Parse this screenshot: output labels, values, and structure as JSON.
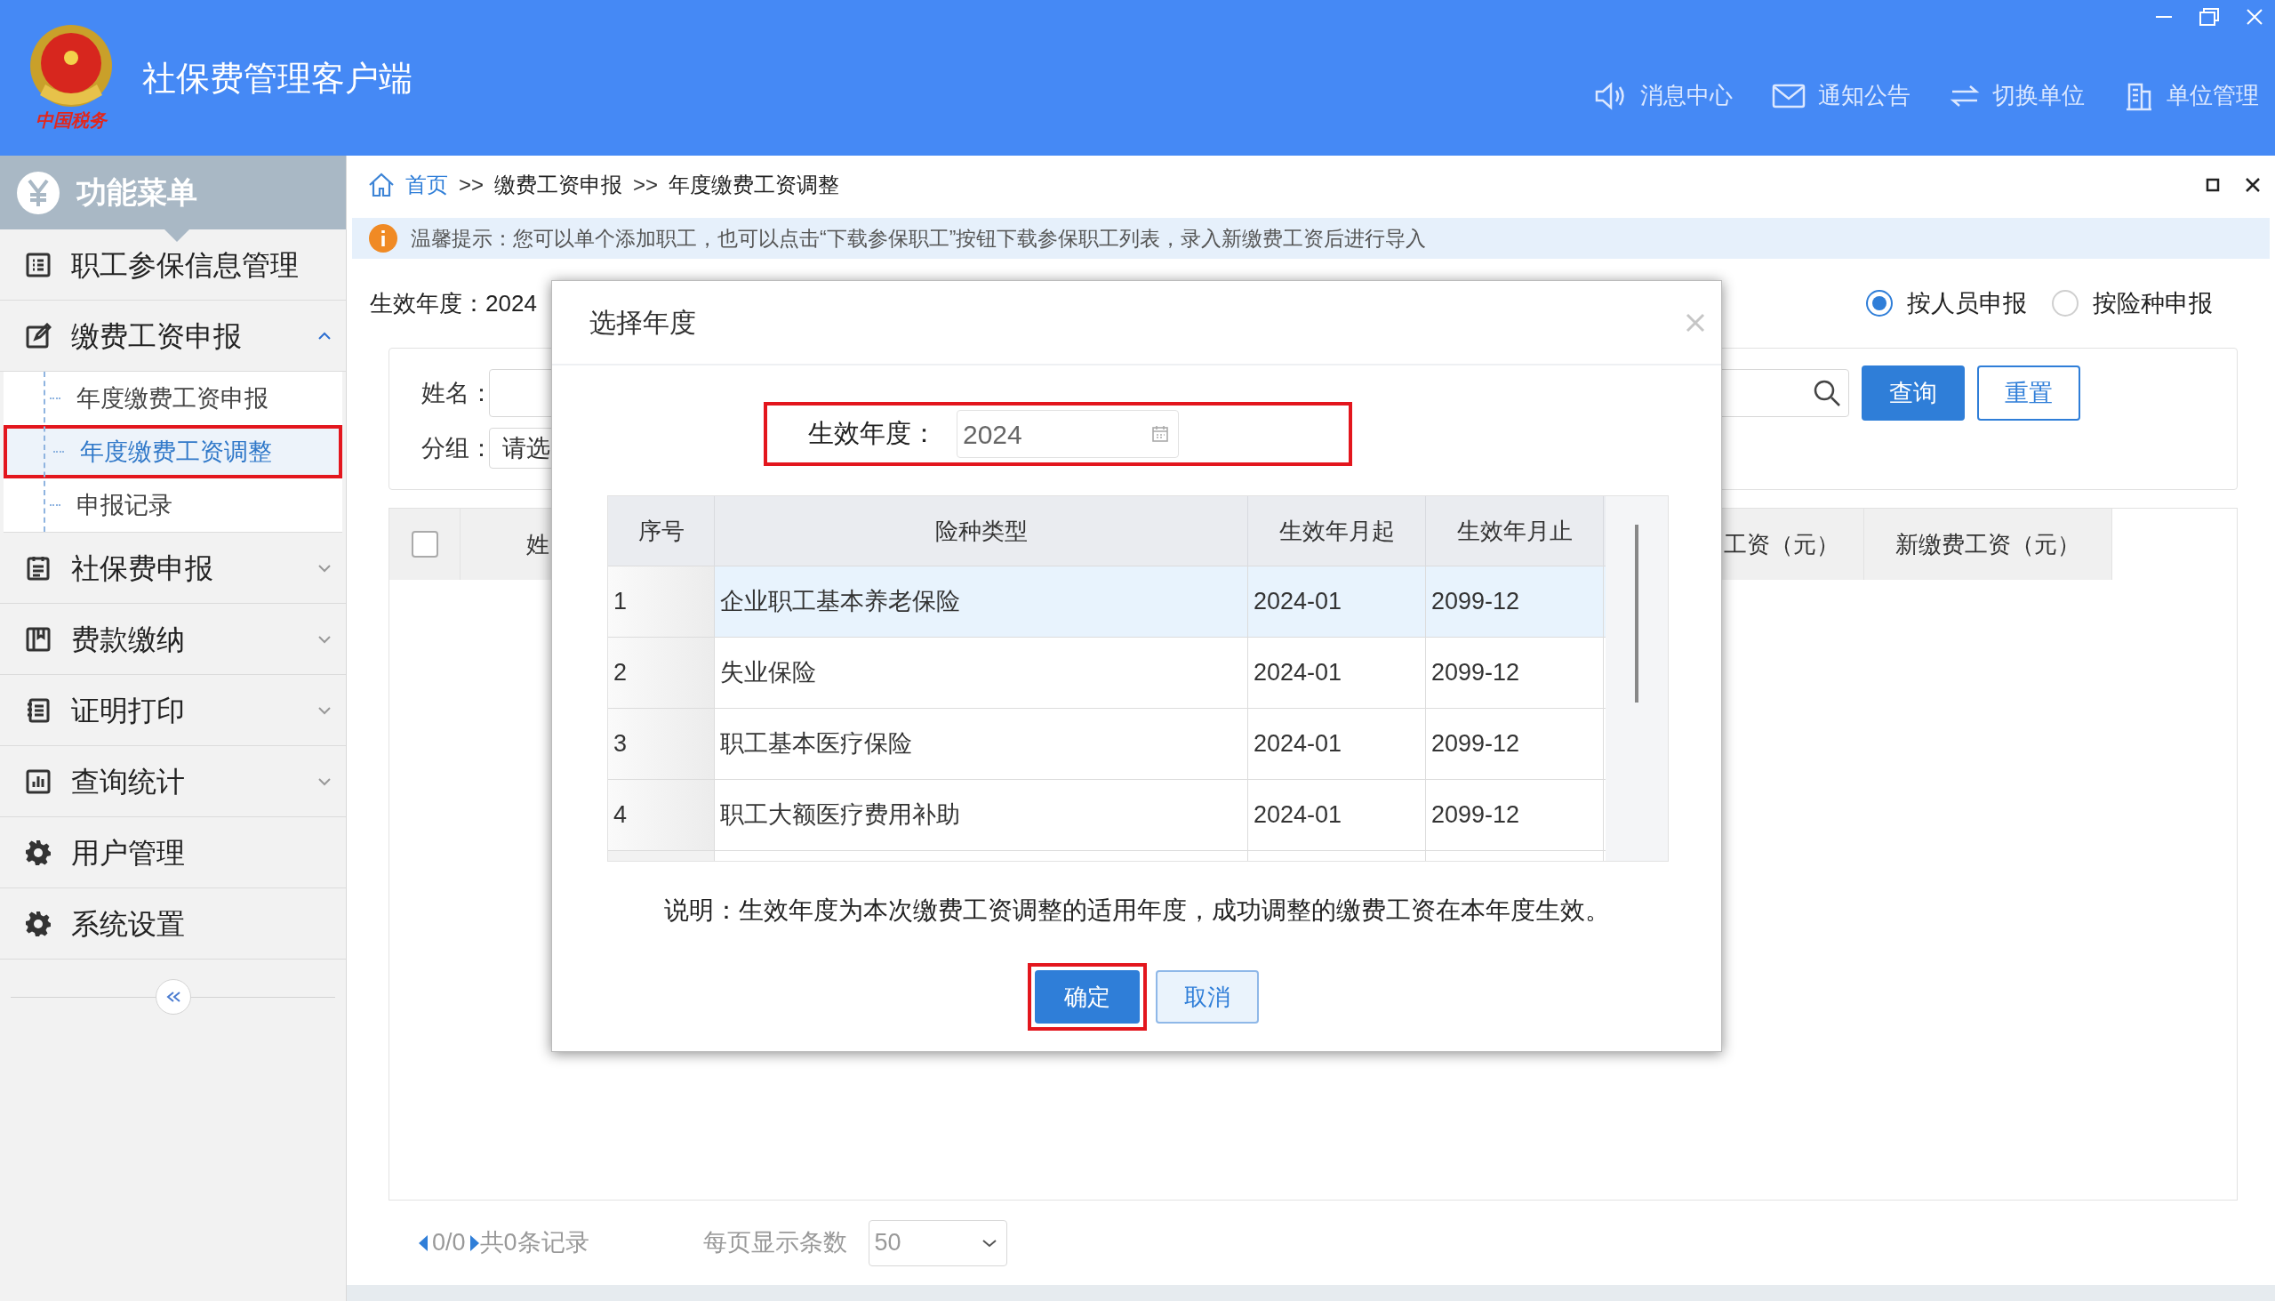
{
  "app": {
    "title": "社保费管理客户端",
    "logo_text": "中国税务",
    "actions": [
      {
        "label": "消息中心"
      },
      {
        "label": "通知公告"
      },
      {
        "label": "切换单位"
      },
      {
        "label": "单位管理"
      }
    ]
  },
  "sidebar": {
    "title": "功能菜单",
    "items": [
      {
        "label": "职工参保信息管理"
      },
      {
        "label": "缴费工资申报",
        "expanded": true,
        "children": [
          {
            "label": "年度缴费工资申报",
            "selected": false
          },
          {
            "label": "年度缴费工资调整",
            "selected": true
          },
          {
            "label": "申报记录",
            "selected": false
          }
        ]
      },
      {
        "label": "社保费申报",
        "expanded": false
      },
      {
        "label": "费款缴纳",
        "expanded": false
      },
      {
        "label": "证明打印",
        "expanded": false
      },
      {
        "label": "查询统计",
        "expanded": false
      },
      {
        "label": "用户管理"
      },
      {
        "label": "系统设置"
      }
    ]
  },
  "breadcrumb": {
    "separator": ">>",
    "items": [
      "首页",
      "缴费工资申报",
      "年度缴费工资调整"
    ]
  },
  "tip": "温馨提示：您可以单个添加职工，也可以点击“下载参保职工”按钮下载参保职工列表，录入新缴费工资后进行导入",
  "effective_year": {
    "label": "生效年度：",
    "value": "2024"
  },
  "report_modes": [
    {
      "label": "按人员申报",
      "selected": true
    },
    {
      "label": "按险种申报",
      "selected": false
    }
  ],
  "search": {
    "name_label": "姓名：",
    "group_label": "分组：",
    "group_value": "请选",
    "buttons": [
      {
        "label": "查询",
        "kind": "primary"
      },
      {
        "label": "重置",
        "kind": "outline"
      }
    ]
  },
  "table": {
    "columns": [
      "姓",
      "工资（元）",
      "新缴费工资（元）"
    ],
    "select_all": false
  },
  "pagination": {
    "page": "0/0",
    "total": "共0条记录",
    "page_size_label": "每页显示条数",
    "page_size": "50"
  },
  "dialog": {
    "title": "选择年度",
    "field": {
      "label": "生效年度：",
      "value": "2024"
    },
    "table": {
      "columns": [
        "序号",
        "险种类型",
        "生效年月起",
        "生效年月止"
      ],
      "rows": [
        {
          "cells": [
            "1",
            "企业职工基本养老保险",
            "2024-01",
            "2099-12"
          ],
          "selected": true
        },
        {
          "cells": [
            "2",
            "失业保险",
            "2024-01",
            "2099-12"
          ],
          "selected": false
        },
        {
          "cells": [
            "3",
            "职工基本医疗保险",
            "2024-01",
            "2099-12"
          ],
          "selected": false
        },
        {
          "cells": [
            "4",
            "职工大额医疗费用补助",
            "2024-01",
            "2099-12"
          ],
          "selected": false
        }
      ]
    },
    "note": "说明：生效年度为本次缴费工资调整的适用年度，成功调整的缴费工资在本年度生效。",
    "buttons": [
      {
        "label": "确定",
        "kind": "primary"
      },
      {
        "label": "取消",
        "kind": "secondary"
      }
    ]
  }
}
